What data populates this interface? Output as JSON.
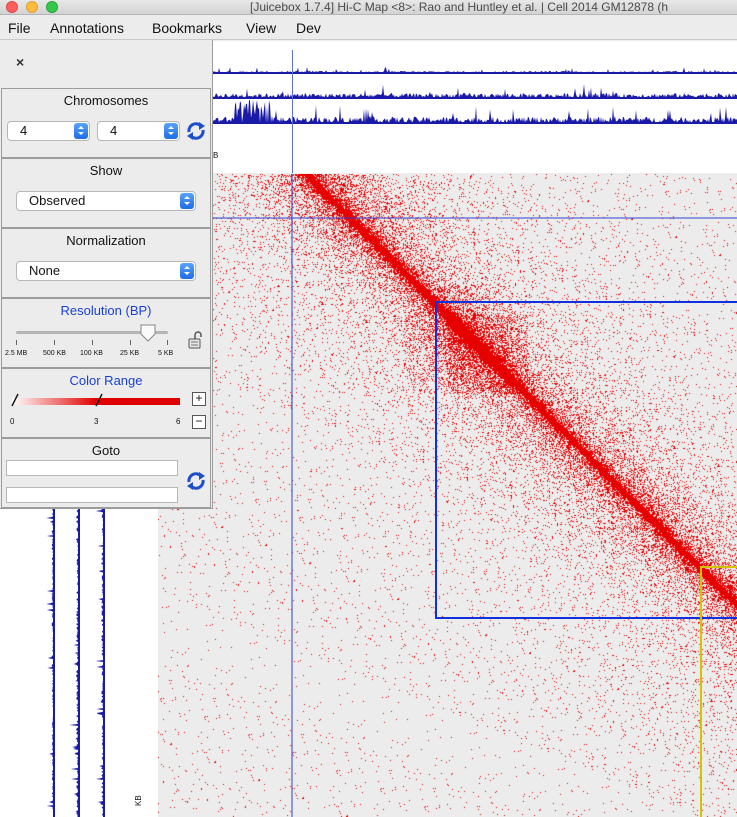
{
  "window": {
    "title": "[Juicebox 1.7.4] Hi-C Map <8>: Rao and Huntley et al. | Cell 2014  GM12878 (h"
  },
  "menu": [
    "File",
    "Annotations",
    "Bookmarks",
    "View",
    "Dev"
  ],
  "tracks": {
    "top_unit": "B",
    "left_unit": "KB",
    "color": "#1a1aa8"
  },
  "panel": {
    "close_glyph": "×",
    "chromosomes": {
      "title": "Chromosomes",
      "chr_x": "4",
      "chr_y": "4"
    },
    "show": {
      "title": "Show",
      "value": "Observed"
    },
    "normalization": {
      "title": "Normalization",
      "value": "None"
    },
    "resolution": {
      "title": "Resolution (BP)",
      "ticks": [
        "2.5 MB",
        "500 KB",
        "100 KB",
        "25 KB",
        "5 KB"
      ],
      "level_fraction": 0.87
    },
    "color_range": {
      "title": "Color Range",
      "labels": [
        "0",
        "3",
        "6"
      ],
      "plus": "+",
      "minus": "−",
      "low_fraction": 0.0,
      "high_fraction": 0.5
    },
    "goto": {
      "title": "Goto",
      "field1": "",
      "field2": ""
    }
  },
  "colors": {
    "heat": "#e00000",
    "domain_box": "#1030e0",
    "yellow_box": "#d6c300",
    "crosshair": "#3040d0",
    "select_blue": "#1d6de6",
    "title_blue": "#1a3fd6"
  }
}
